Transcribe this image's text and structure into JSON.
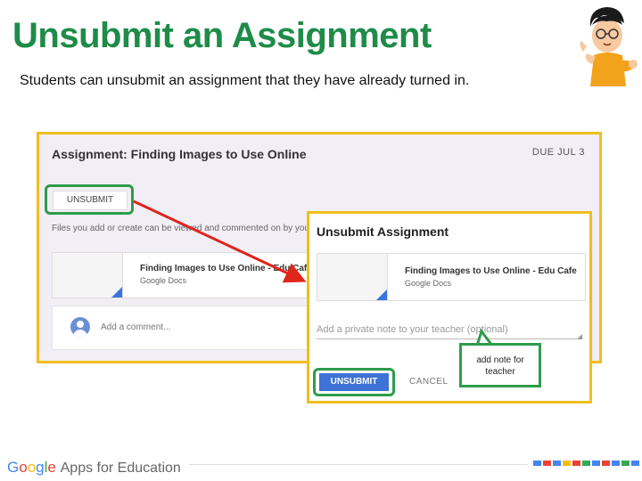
{
  "page": {
    "title": "Unsubmit an Assignment",
    "subtitle": "Students can unsubmit an assignment that they have already turned in."
  },
  "assignment_view": {
    "title": "Assignment: Finding Images to Use Online",
    "due": "DUE JUL 3",
    "unsubmit_label": "UNSUBMIT",
    "files_text": "Files you add or create can be viewed and commented on by your te",
    "file": {
      "name": "Finding Images to Use Online - Edu Cafe",
      "type": "Google Docs"
    },
    "comment_placeholder": "Add a comment..."
  },
  "dialog": {
    "title": "Unsubmit Assignment",
    "file": {
      "name": "Finding Images to Use Online - Edu Cafe",
      "type": "Google Docs"
    },
    "note_placeholder": "Add a private note to your teacher (optional)",
    "unsubmit_label": "UNSUBMIT",
    "cancel_label": "CANCEL"
  },
  "callout": {
    "text": "add note for teacher"
  },
  "footer": {
    "logo_google": "Google",
    "logo_suffix": "Apps for Education"
  },
  "colors": {
    "title_green": "#1e8c48",
    "frame_yellow": "#f0be1e",
    "highlight_green": "#2e9c4a",
    "button_blue": "#3d73d6",
    "arrow_red": "#e0251b"
  }
}
